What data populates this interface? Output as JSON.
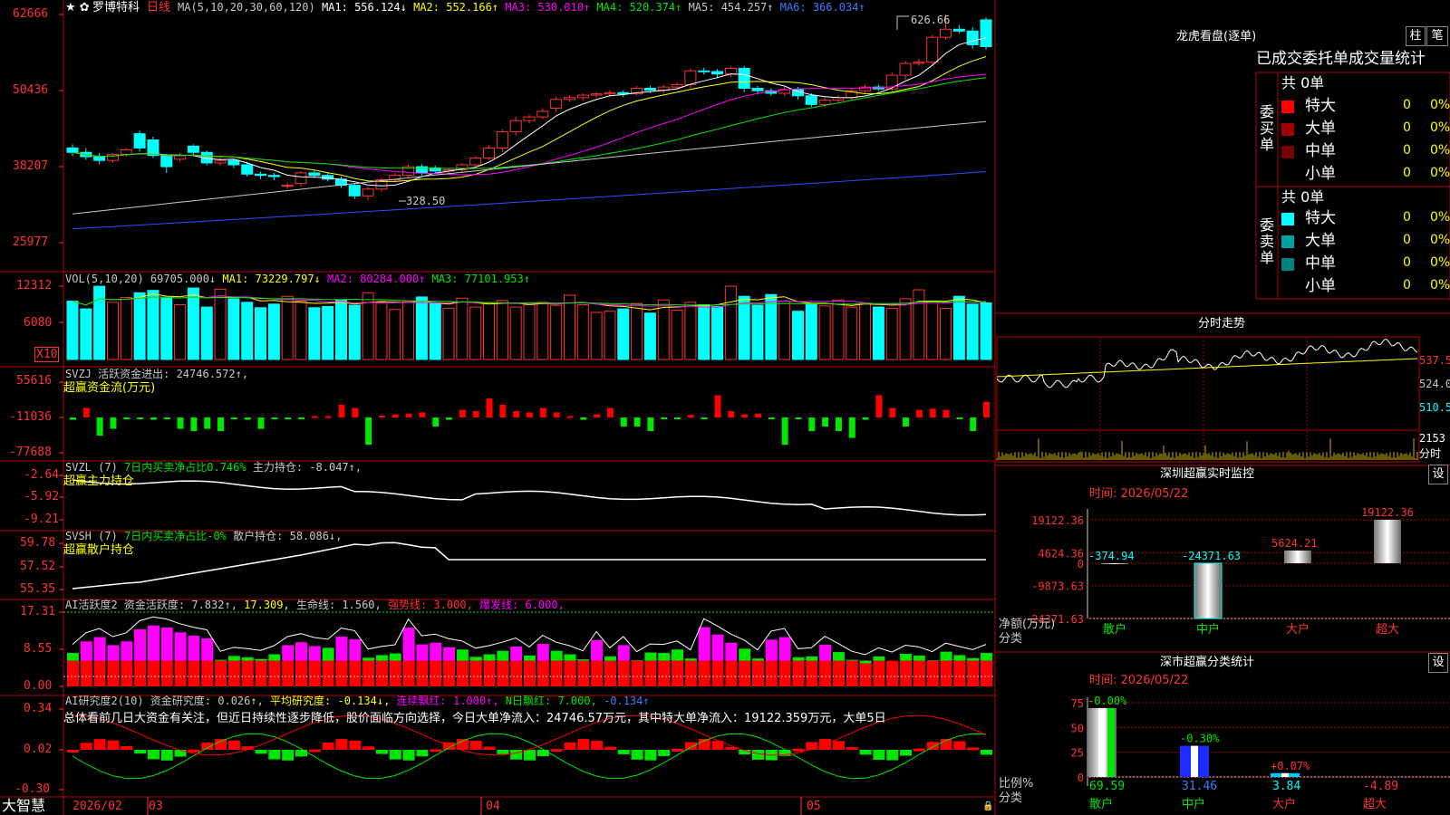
{
  "stock": {
    "name": "罗博特科",
    "period": "日线",
    "stars": "★ ✿"
  },
  "ma_legend": [
    {
      "t": "MA(5,10,20,30,60,120)",
      "c": "#c8c8c8"
    },
    {
      "t": "MA1: 556.124↓",
      "c": "#ffffff"
    },
    {
      "t": "MA2: 552.166↑",
      "c": "#ffff00"
    },
    {
      "t": "MA3: 530.010↑",
      "c": "#ff00ff"
    },
    {
      "t": "MA4: 520.374↑",
      "c": "#00e600"
    },
    {
      "t": "MA5: 454.257↑",
      "c": "#c8c8c8"
    },
    {
      "t": "MA6: 366.034↑",
      "c": "#3c7cff"
    }
  ],
  "main_axis": [
    "62666",
    "50436",
    "38207",
    "25977"
  ],
  "price_marks": {
    "high": "626.66",
    "low": "328.50"
  },
  "vol": {
    "legend": [
      {
        "t": "VOL(5,10,20)",
        "c": "#c8c8c8"
      },
      {
        "t": "69705.000↓",
        "c": "#c8c8c8"
      },
      {
        "t": "MA1: 73229.797↓",
        "c": "#ffff00"
      },
      {
        "t": "MA2: 80284.000↑",
        "c": "#ff00ff"
      },
      {
        "t": "MA3: 77101.953↑",
        "c": "#00e600"
      }
    ],
    "axis": [
      "12312",
      "6080"
    ],
    "unit": "X10"
  },
  "svzj": {
    "legend": [
      {
        "t": "SVZJ  活跃资金进出: 24746.572↑,",
        "c": "#c8c8c8"
      }
    ],
    "sub": "超赢资金流(万元)",
    "axis": [
      "55616",
      "-11036",
      "-77688"
    ]
  },
  "svzl": {
    "legend": [
      {
        "t": "SVZL (7)",
        "c": "#c8c8c8"
      },
      {
        "t": "7日内买卖净占比0.746%",
        "c": "#00e600"
      },
      {
        "t": "主力持仓: -8.047↑,",
        "c": "#c8c8c8"
      }
    ],
    "sub": "超赢主力持仓",
    "axis": [
      "-2.64",
      "-5.92",
      "-9.21"
    ]
  },
  "svsh": {
    "legend": [
      {
        "t": "SVSH (7)",
        "c": "#c8c8c8"
      },
      {
        "t": "7日内买卖净占比-0%",
        "c": "#00e600"
      },
      {
        "t": "散户持仓: 58.086↓,",
        "c": "#c8c8c8"
      }
    ],
    "sub": "超赢散户持仓",
    "axis": [
      "59.78",
      "57.52",
      "55.35"
    ]
  },
  "ai1": {
    "legend": [
      {
        "t": "AI活跃度2 资金活跃度: 7.832↑,",
        "c": "#c8c8c8"
      },
      {
        "t": "17.309,",
        "c": "#ffff00"
      },
      {
        "t": "生命线: 1.560,",
        "c": "#c8c8c8"
      },
      {
        "t": "强势线: 3.000,",
        "c": "#ff3232"
      },
      {
        "t": "爆发线: 6.000,",
        "c": "#ff00ff"
      }
    ],
    "axis": [
      "17.31",
      "8.55",
      "0.00"
    ]
  },
  "ai2": {
    "legend": [
      {
        "t": "AI研究度2(10) 资金研究度: 0.026↑,",
        "c": "#c8c8c8"
      },
      {
        "t": "平均研究度: -0.134↓,",
        "c": "#ffff00"
      },
      {
        "t": "连续飘红: 1.000↑,",
        "c": "#ff00ff"
      },
      {
        "t": "N日飘红: 7.000,",
        "c": "#00e600"
      },
      {
        "t": "-0.134↑",
        "c": "#3c7cff"
      }
    ],
    "comment": "总体看前几日大资金有关注，但近日持续性逐步降低，股价面临方向选择，今日大单净流入：24746.57万元，其中特大单净流入：19122.359万元，大单5日",
    "axis": [
      "0.34",
      "0.02",
      "-0.30"
    ]
  },
  "bottom_axis": {
    "brand": "大智慧",
    "dates": [
      "2026/02",
      "03",
      "04",
      "05"
    ]
  },
  "lhb": {
    "title": "龙虎看盘(逐单)",
    "btn1": "柱",
    "btn2": "笔",
    "tabs": "已成交委托单成交量统计",
    "buy_label": "委买单",
    "sell_label": "委卖单",
    "buy_total": "共 0单",
    "sell_total": "共 0单",
    "rows": [
      {
        "name": "特大",
        "v": "0",
        "p": "0%"
      },
      {
        "name": "大单",
        "v": "0",
        "p": "0%"
      },
      {
        "name": "中单",
        "v": "0",
        "p": "0%"
      },
      {
        "name": "小单",
        "v": "0",
        "p": "0%"
      }
    ],
    "buy_colors": [
      "#ff0000",
      "#a00000",
      "#780000",
      ""
    ],
    "sell_colors": [
      "#00ffff",
      "#00a0a0",
      "#008080",
      ""
    ]
  },
  "fenshi": {
    "title": "分时走势",
    "axis": [
      "537.5",
      "524.0",
      "510.5",
      "2153",
      "分时"
    ]
  },
  "szmon": {
    "title": "深圳超赢实时监控",
    "btn": "设",
    "time": "时间: 2026/05/22",
    "axis": [
      "19122.36",
      "4624.36",
      "0",
      "-9873.63",
      "-24371.63"
    ],
    "ylabel": "净额(万元)",
    "xlabel": "分类",
    "cats": [
      "散户",
      "中户",
      "大户",
      "超大"
    ],
    "values": [
      -374.94,
      -24371.63,
      5624.21,
      19122.36
    ],
    "value_labels": [
      "-374.94",
      "-24371.63",
      "5624.21",
      "19122.36"
    ]
  },
  "szcls": {
    "title": "深市超赢分类统计",
    "btn": "设",
    "time": "时间: 2026/05/22",
    "axis": [
      "75",
      "50",
      "25",
      "0"
    ],
    "ylabel": "比例%",
    "xlabel": "分类",
    "cats": [
      "散户",
      "中户",
      "大户",
      "超大"
    ],
    "values": [
      69.59,
      31.46,
      3.84,
      -4.89
    ],
    "value_labels": [
      "69.59",
      "31.46",
      "3.84",
      "-4.89"
    ],
    "change_labels": [
      "-0.00%",
      "-0.30%",
      "+0.07%",
      ""
    ]
  },
  "chart_data": [
    {
      "type": "candlestick",
      "title": "罗博特科 日线",
      "ylim": [
        259.77,
        626.66
      ],
      "note": "values in price (axis labels shown x100)",
      "open": [
        412,
        405,
        398,
        392,
        402,
        435,
        425,
        400,
        394,
        415,
        405,
        388,
        392,
        385,
        370,
        368,
        352,
        355,
        372,
        368,
        362,
        352,
        335,
        346,
        361,
        368,
        382,
        380,
        375,
        377,
        385,
        396,
        412,
        438,
        456,
        462,
        476,
        490,
        493,
        497,
        499,
        501,
        499,
        508,
        505,
        510,
        514,
        536,
        535,
        531,
        540,
        508,
        504,
        500,
        506,
        496,
        482,
        489,
        493,
        504,
        510,
        507,
        529,
        548,
        550,
        590,
        603,
        600,
        618
      ],
      "close": [
        405,
        398,
        392,
        402,
        409,
        412,
        400,
        382,
        400,
        405,
        388,
        392,
        385,
        370,
        368,
        366,
        352,
        372,
        368,
        362,
        352,
        335,
        346,
        361,
        368,
        382,
        372,
        375,
        377,
        385,
        396,
        412,
        438,
        456,
        462,
        471,
        490,
        493,
        497,
        499,
        501,
        499,
        508,
        505,
        510,
        514,
        536,
        535,
        531,
        540,
        508,
        504,
        500,
        506,
        496,
        482,
        489,
        493,
        504,
        510,
        507,
        529,
        548,
        550,
        590,
        603,
        600,
        578,
        575
      ],
      "high": [
        418,
        412,
        404,
        404,
        412,
        440,
        430,
        402,
        404,
        418,
        408,
        396,
        394,
        390,
        374,
        372,
        356,
        375,
        376,
        372,
        366,
        356,
        350,
        364,
        372,
        386,
        386,
        384,
        380,
        388,
        399,
        416,
        442,
        462,
        466,
        476,
        494,
        497,
        500,
        502,
        505,
        505,
        512,
        512,
        514,
        518,
        540,
        541,
        539,
        544,
        544,
        512,
        508,
        510,
        510,
        500,
        494,
        497,
        508,
        514,
        514,
        533,
        552,
        556,
        594,
        626.66,
        610,
        606,
        622
      ],
      "low": [
        399,
        393,
        386,
        388,
        398,
        406,
        396,
        372,
        390,
        400,
        384,
        384,
        380,
        366,
        362,
        360,
        346,
        350,
        364,
        358,
        348,
        330,
        328.5,
        342,
        358,
        364,
        368,
        372,
        370,
        374,
        381,
        392,
        406,
        432,
        452,
        458,
        470,
        486,
        488,
        493,
        494,
        494,
        496,
        500,
        500,
        506,
        508,
        530,
        524,
        526,
        502,
        498,
        496,
        496,
        490,
        478,
        478,
        485,
        488,
        500,
        504,
        503,
        522,
        544,
        546,
        586,
        596,
        572,
        570
      ]
    },
    {
      "type": "bar",
      "title": "VOL(5,10,20)",
      "values": [
        9800,
        8500,
        12300,
        9600,
        10400,
        11200,
        11600,
        10300,
        9200,
        12000,
        8800,
        11800,
        10200,
        9600,
        8700,
        9300,
        10600,
        9800,
        8700,
        8900,
        10000,
        9100,
        11200,
        9500,
        8400,
        9700,
        10500,
        9400,
        8600,
        10300,
        8800,
        9500,
        9900,
        8800,
        9200,
        9600,
        9100,
        10800,
        9200,
        7900,
        8100,
        8500,
        9400,
        7800,
        10000,
        8300,
        9600,
        9200,
        8900,
        12300,
        10600,
        9100,
        10900,
        9800,
        8100,
        9400,
        9000,
        10000,
        8800,
        9500,
        8800,
        8600,
        10200,
        11700,
        9800,
        8600,
        10600,
        9300,
        9500
      ],
      "unit": "X10"
    },
    {
      "type": "bar",
      "title": "SVZJ 超赢资金流(万元)",
      "values": [
        -5000,
        15000,
        -40000,
        -25000,
        -3000,
        -2000,
        -5000,
        -2000,
        -25000,
        -30000,
        -25000,
        -30000,
        -2000,
        -5000,
        -25000,
        -3000,
        -4000,
        -2000,
        2000,
        2000,
        20000,
        15000,
        -60000,
        3000,
        5000,
        6000,
        8000,
        -20000,
        -5000,
        12000,
        10000,
        30000,
        20000,
        10000,
        8000,
        15000,
        8000,
        2000,
        -5000,
        5000,
        15000,
        -20000,
        -20000,
        -30000,
        -3000,
        -4000,
        4000,
        -3000,
        35000,
        10000,
        5000,
        6000,
        -3000,
        -60000,
        -2000,
        -30000,
        -20000,
        -30000,
        -45000,
        -5000,
        35000,
        15000,
        -20000,
        12000,
        14000,
        12000,
        -3000,
        -30000,
        24746.572
      ],
      "ylim": [
        -77688,
        55616
      ]
    },
    {
      "type": "bar",
      "title": "AI活跃度2",
      "values": [
        7.8,
        10.5,
        11.5,
        9.6,
        10.5,
        13.3,
        14.2,
        13.7,
        12.6,
        11.8,
        11.2,
        6.2,
        7.1,
        6.8,
        6.4,
        7.5,
        9.6,
        10.3,
        9.4,
        9.0,
        11.6,
        11.0,
        6.7,
        7.3,
        7.7,
        13.7,
        9.8,
        10.2,
        9.1,
        8.6,
        6.9,
        7.5,
        8.3,
        9.3,
        7.2,
        9.9,
        8.3,
        7.5,
        6.3,
        10.8,
        7.0,
        9.6,
        6.1,
        7.9,
        7.8,
        8.6,
        6.5,
        13.8,
        12.1,
        10.2,
        8.8,
        6.5,
        10.9,
        11.5,
        6.8,
        7.0,
        9.7,
        8.0,
        6.2,
        5.4,
        7.0,
        6.0,
        7.6,
        7.2,
        6.1,
        8.1,
        7.3,
        6.6,
        7.8
      ],
      "ylim": [
        0,
        17.31
      ]
    }
  ]
}
